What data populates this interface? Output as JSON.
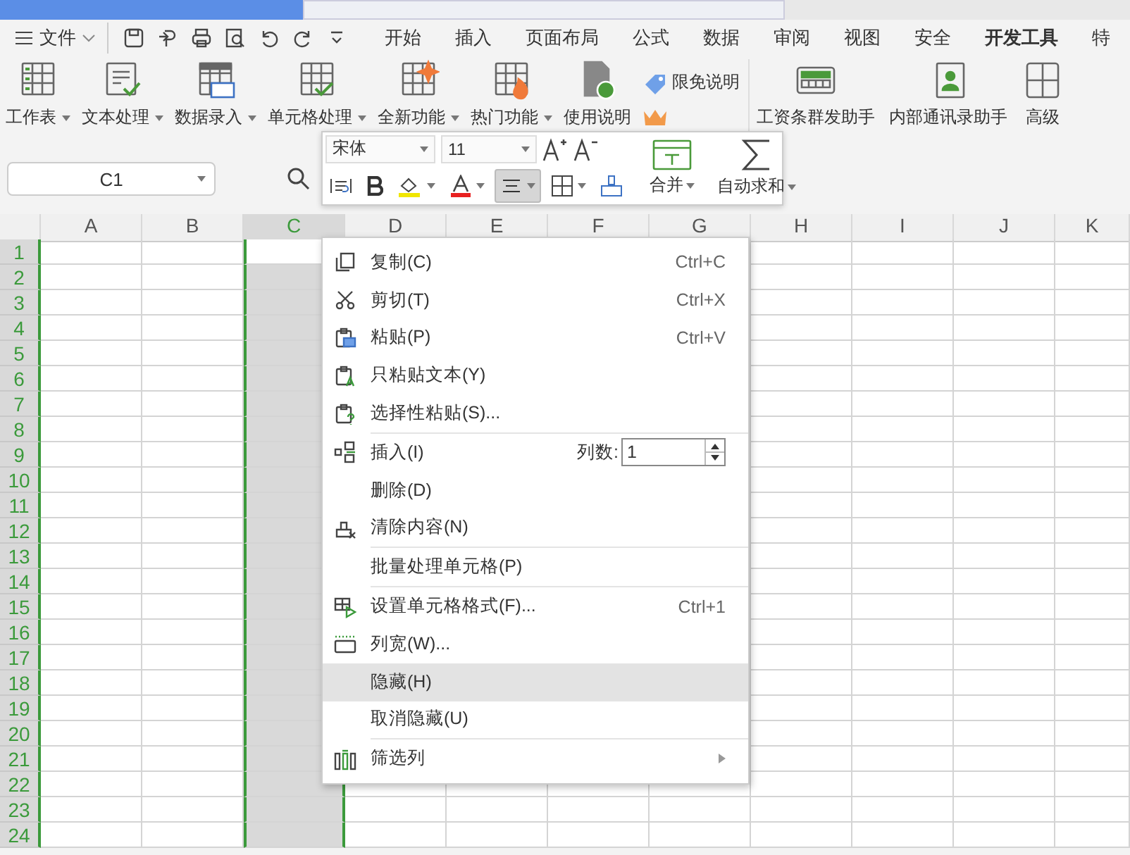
{
  "file_menu": {
    "label": "文件"
  },
  "quick_tools": [
    {
      "kind": "save"
    },
    {
      "kind": "paint"
    },
    {
      "kind": "print"
    },
    {
      "kind": "preview"
    },
    {
      "kind": "undo"
    },
    {
      "kind": "redo"
    },
    {
      "kind": "more"
    }
  ],
  "menu_tabs": [
    {
      "label": "开始",
      "selected": false
    },
    {
      "label": "插入",
      "selected": false
    },
    {
      "label": "页面布局",
      "selected": false
    },
    {
      "label": "公式",
      "selected": false
    },
    {
      "label": "数据",
      "selected": false
    },
    {
      "label": "审阅",
      "selected": false
    },
    {
      "label": "视图",
      "selected": false
    },
    {
      "label": "安全",
      "selected": false
    },
    {
      "label": "开发工具",
      "selected": true
    },
    {
      "label": "特",
      "selected": false
    }
  ],
  "ribbon": [
    {
      "kind": "sheet",
      "label": "工作表",
      "dropdown": true
    },
    {
      "kind": "text",
      "label": "文本处理",
      "dropdown": true
    },
    {
      "kind": "data",
      "label": "数据录入",
      "dropdown": true
    },
    {
      "kind": "cells",
      "label": "单元格处理",
      "dropdown": true
    },
    {
      "kind": "new",
      "label": "全新功能",
      "dropdown": true
    },
    {
      "kind": "hot",
      "label": "热门功能",
      "dropdown": true
    },
    {
      "kind": "doc",
      "label": "使用说明",
      "dropdown": false
    }
  ],
  "ribbon_small": {
    "label": "限免说明"
  },
  "ribbon_right": [
    {
      "kind": "salary",
      "label": "工资条群发助手"
    },
    {
      "kind": "contact",
      "label": "内部通讯录助手"
    },
    {
      "kind": "calc",
      "label": "高级"
    }
  ],
  "name_box": {
    "value": "C1"
  },
  "mini_toolbar": {
    "font": "宋体",
    "size": "11",
    "align_pressed": true,
    "merge": "合并",
    "autosum": "自动求和"
  },
  "columns": [
    {
      "label": "A",
      "selected": false
    },
    {
      "label": "B",
      "selected": false
    },
    {
      "label": "C",
      "selected": true
    },
    {
      "label": "D",
      "selected": false
    },
    {
      "label": "E",
      "selected": false
    },
    {
      "label": "F",
      "selected": false
    },
    {
      "label": "G",
      "selected": false
    },
    {
      "label": "H",
      "selected": false
    },
    {
      "label": "I",
      "selected": false
    },
    {
      "label": "J",
      "selected": false
    },
    {
      "label": "K",
      "selected": false
    }
  ],
  "rows": [
    "1",
    "2",
    "3",
    "4",
    "5",
    "6",
    "7",
    "8",
    "9",
    "10",
    "11",
    "12",
    "13",
    "14",
    "15",
    "16",
    "17",
    "18",
    "19",
    "20",
    "21",
    "22",
    "23",
    "24"
  ],
  "context_menu": [
    {
      "kind": "copy",
      "label": "复制(C)",
      "shortcut": "Ctrl+C",
      "selected": false,
      "separator": false
    },
    {
      "kind": "cut",
      "label": "剪切(T)",
      "shortcut": "Ctrl+X",
      "selected": false,
      "separator": false
    },
    {
      "kind": "paste",
      "label": "粘贴(P)",
      "shortcut": "Ctrl+V",
      "selected": false,
      "separator": false
    },
    {
      "kind": "pastetext",
      "label": "只粘贴文本(Y)",
      "selected": false,
      "separator": false
    },
    {
      "kind": "pastespecial",
      "label": "选择性粘贴(S)...",
      "selected": false,
      "separator": false
    },
    {
      "kind": "insert",
      "label": "插入(I)",
      "count_label": "列数:",
      "count": "1",
      "selected": false,
      "separator": true
    },
    {
      "kind": "none",
      "label": "删除(D)",
      "selected": false,
      "separator": false
    },
    {
      "kind": "clear",
      "label": "清除内容(N)",
      "selected": false,
      "separator": false
    },
    {
      "kind": "none",
      "label": "批量处理单元格(P)",
      "selected": false,
      "separator": true
    },
    {
      "kind": "format",
      "label": "设置单元格格式(F)...",
      "shortcut": "Ctrl+1",
      "selected": false,
      "separator": true
    },
    {
      "kind": "width",
      "label": "列宽(W)...",
      "selected": false,
      "separator": false
    },
    {
      "kind": "none",
      "label": "隐藏(H)",
      "selected": true,
      "separator": false
    },
    {
      "kind": "none",
      "label": "取消隐藏(U)",
      "selected": false,
      "separator": false
    },
    {
      "kind": "filter",
      "label": "筛选列",
      "submenu": true,
      "selected": false,
      "separator": true
    }
  ]
}
